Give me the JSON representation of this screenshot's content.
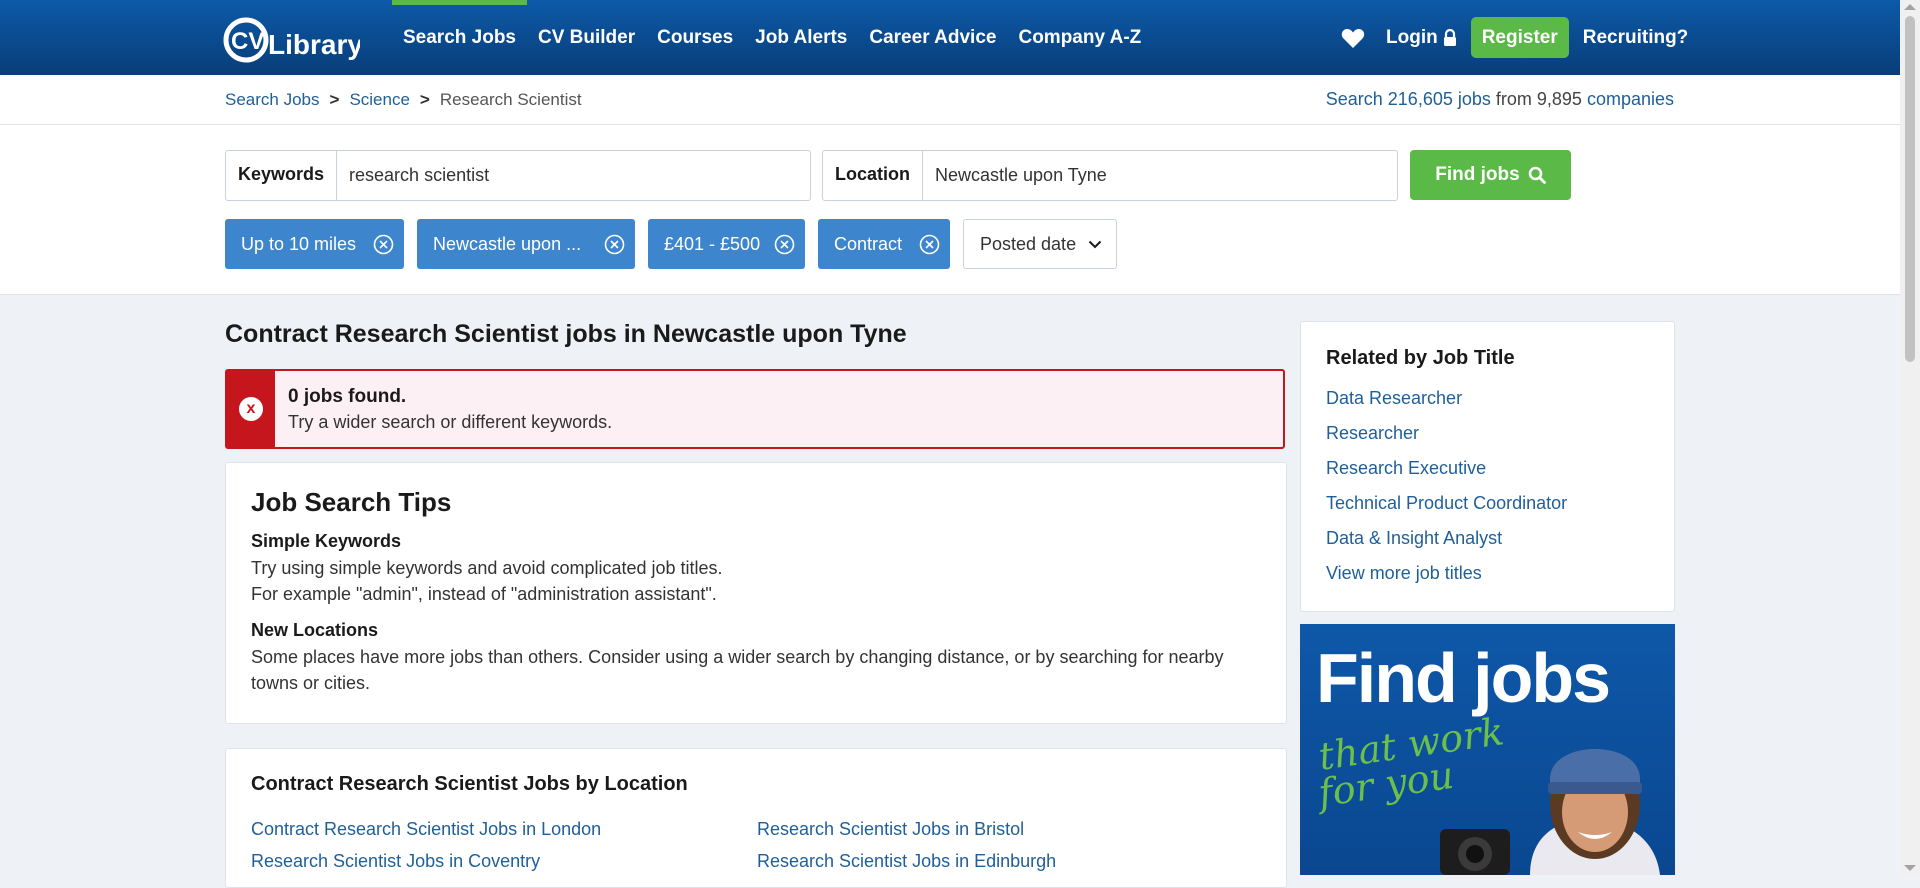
{
  "header": {
    "logo_text": "CV Library",
    "nav": [
      "Search Jobs",
      "CV Builder",
      "Courses",
      "Job Alerts",
      "Career Advice",
      "Company A-Z"
    ],
    "login": "Login",
    "register": "Register",
    "recruiting": "Recruiting?"
  },
  "breadcrumb": {
    "items": [
      "Search Jobs",
      "Science",
      "Research Scientist"
    ],
    "sep": ">"
  },
  "stats": {
    "prefix": "Search",
    "jobs": "216,605 jobs",
    "mid": "from 9,895",
    "companies": "companies"
  },
  "search": {
    "keywords_label": "Keywords",
    "keywords_value": "research scientist",
    "location_label": "Location",
    "location_value": "Newcastle upon Tyne",
    "find_label": "Find jobs",
    "filters": [
      "Up to 10 miles",
      "Newcastle upon ...",
      "£401 - £500",
      "Contract"
    ],
    "posted_label": "Posted date"
  },
  "main": {
    "title": "Contract Research Scientist jobs in Newcastle upon Tyne",
    "alert_title": "0 jobs found.",
    "alert_text": "Try a wider search or different keywords.",
    "tips": {
      "title": "Job Search Tips",
      "h1": "Simple Keywords",
      "p1a": "Try using simple keywords and avoid complicated job titles.",
      "p1b": "For example \"admin\", instead of \"administration assistant\".",
      "h2": "New Locations",
      "p2": "Some places have more jobs than others. Consider using a wider search by changing distance, or by searching for nearby towns or cities."
    },
    "by_location": {
      "title": "Contract Research Scientist Jobs by Location",
      "links": [
        "Contract Research Scientist Jobs in London",
        "Research Scientist Jobs in Bristol",
        "Research Scientist Jobs in Coventry",
        "Research Scientist Jobs in Edinburgh"
      ]
    }
  },
  "sidebar": {
    "title": "Related by Job Title",
    "links": [
      "Data Researcher",
      "Researcher",
      "Research Executive",
      "Technical Product Coordinator",
      "Data & Insight Analyst",
      "View more job titles"
    ]
  },
  "ad": {
    "headline": "Find jobs",
    "sub1": "that work",
    "sub2": "for you"
  },
  "colors": {
    "header_blue": "#0a4a8e",
    "accent_green": "#5bb947",
    "chip_blue": "#3d85cc",
    "link_blue": "#1f5f99",
    "error_red": "#c4161c"
  }
}
